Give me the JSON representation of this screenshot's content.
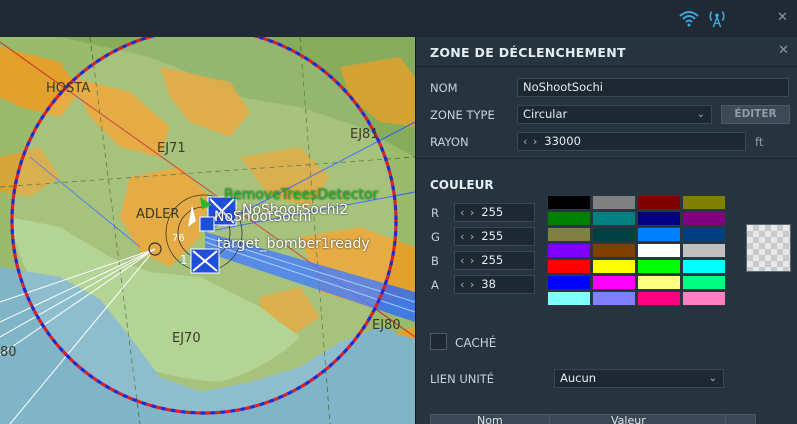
{
  "topbar": {
    "wifi_icon": "wifi-icon",
    "antenna_icon": "antenna-icon",
    "close_icon": "close-icon",
    "wifi_color": "#3aa8d8",
    "antenna_color": "#3aa8d8"
  },
  "map": {
    "labels": {
      "hosta": "HOSTA",
      "adler": "ADLER",
      "ej71": "EJ71",
      "ej81": "EJ81",
      "ej70": "EJ70",
      "ej80": "EJ80",
      "left_num": "80",
      "unit_count": "76",
      "unit_index": "1"
    },
    "units": {
      "label1": "RemoveTreesDetector",
      "label2": "NoShootSochi2",
      "label3": "NoShootSochi",
      "label4": "target_bomber1ready"
    },
    "zone_border_colors": [
      "#1b2bd6",
      "#e02020"
    ]
  },
  "panel": {
    "title": "ZONE DE DÉCLENCHEMENT",
    "close_icon": "close-icon",
    "nom_label": "NOM",
    "nom_value": "NoShootSochi",
    "zone_type_label": "ZONE TYPE",
    "zone_type_value": "Circular",
    "edit_button": "ÉDITER",
    "rayon_label": "RAYON",
    "rayon_value": "33000",
    "rayon_unit": "ft",
    "couleur_title": "COULEUR",
    "r_label": "R",
    "r_value": "255",
    "g_label": "G",
    "g_value": "255",
    "b_label": "B",
    "b_value": "255",
    "a_label": "A",
    "a_value": "38",
    "palette": [
      "#000000",
      "#808080",
      "#800000",
      "#808000",
      "#008000",
      "#008080",
      "#000080",
      "#800080",
      "#808040",
      "#004040",
      "#0080ff",
      "#004080",
      "#8000ff",
      "#804000",
      "#ffffff",
      "#c0c0c0",
      "#ff0000",
      "#ffff00",
      "#00ff00",
      "#00ffff",
      "#0000ff",
      "#ff00ff",
      "#ffff80",
      "#00ff80",
      "#80ffff",
      "#8080ff",
      "#ff0080",
      "#ff80c0"
    ],
    "cache_label": "CACHÉ",
    "lien_unite_label": "LIEN UNITÉ",
    "lien_unite_value": "Aucun",
    "table_headers": [
      "Nom",
      "Valeur"
    ]
  }
}
